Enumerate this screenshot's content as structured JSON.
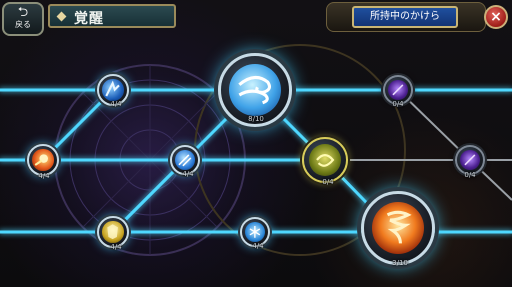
{
  "header": {
    "back_label": "戻る",
    "back_icon": "return-arrow-icon",
    "title": "覚醒",
    "owned_fragments_label": "所持中のかけら",
    "close_icon": "close-x-icon"
  },
  "colors": {
    "link_glow": "#4fd8ff",
    "link_dim": "#8a8e94",
    "accent_blue": "#1f4f9e",
    "gold": "#c9b574"
  },
  "nodes": [
    {
      "id": "n1",
      "icon": "blue-tornado-icon",
      "progress": "4/4",
      "active": true
    },
    {
      "id": "n2",
      "icon": "fire-orb-icon",
      "progress": "4/4",
      "active": true
    },
    {
      "id": "n3",
      "icon": "blue-comet-icon",
      "progress": "4/4",
      "active": true
    },
    {
      "id": "n4",
      "icon": "golden-shield-icon",
      "progress": "4/4",
      "active": true
    },
    {
      "id": "n5",
      "icon": "wind-swirl-icon",
      "progress": "8/10",
      "active": true
    },
    {
      "id": "n6",
      "icon": "snowflake-icon",
      "progress": "4/4",
      "active": true
    },
    {
      "id": "n7",
      "icon": "yellow-swirl-icon",
      "progress": "0/4",
      "active": false
    },
    {
      "id": "n8",
      "icon": "purple-comet-icon",
      "progress": "0/4",
      "active": false
    },
    {
      "id": "n9",
      "icon": "purple-comet-icon",
      "progress": "0/4",
      "active": false
    },
    {
      "id": "n10",
      "icon": "fire-tornado-icon",
      "progress": "3/10",
      "active": true
    }
  ]
}
